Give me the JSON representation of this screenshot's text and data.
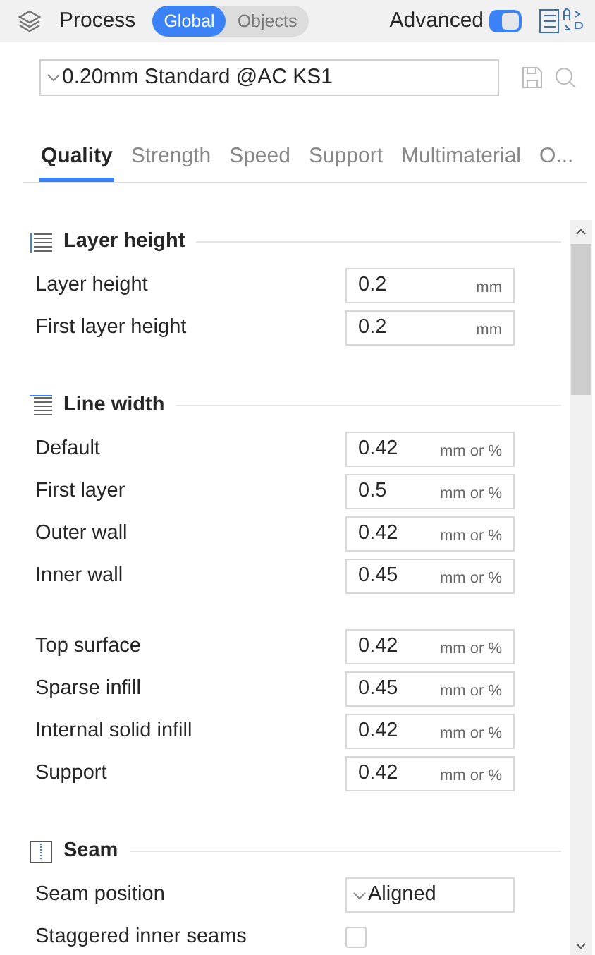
{
  "header": {
    "title": "Process",
    "scope": [
      {
        "label": "Global",
        "selected": true
      },
      {
        "label": "Objects",
        "selected": false
      }
    ],
    "advanced": {
      "label": "Advanced",
      "on": true
    }
  },
  "preset": {
    "value": "0.20mm Standard @AC KS1"
  },
  "tabs": [
    {
      "label": "Quality",
      "selected": true
    },
    {
      "label": "Strength",
      "selected": false
    },
    {
      "label": "Speed",
      "selected": false
    },
    {
      "label": "Support",
      "selected": false
    },
    {
      "label": "Multimaterial",
      "selected": false
    },
    {
      "label": "O...",
      "selected": false
    }
  ],
  "sections": [
    {
      "title": "Layer height",
      "groups": [
        [
          {
            "kind": "field",
            "label": "Layer height",
            "value": "0.2",
            "unit": "mm"
          },
          {
            "kind": "field",
            "label": "First layer height",
            "value": "0.2",
            "unit": "mm"
          }
        ]
      ]
    },
    {
      "title": "Line width",
      "groups": [
        [
          {
            "kind": "field",
            "label": "Default",
            "value": "0.42",
            "unit": "mm or %"
          },
          {
            "kind": "field",
            "label": "First layer",
            "value": "0.5",
            "unit": "mm or %"
          },
          {
            "kind": "field",
            "label": "Outer wall",
            "value": "0.42",
            "unit": "mm or %"
          },
          {
            "kind": "field",
            "label": "Inner wall",
            "value": "0.45",
            "unit": "mm or %"
          }
        ],
        [
          {
            "kind": "field",
            "label": "Top surface",
            "value": "0.42",
            "unit": "mm or %"
          },
          {
            "kind": "field",
            "label": "Sparse infill",
            "value": "0.45",
            "unit": "mm or %"
          },
          {
            "kind": "field",
            "label": "Internal solid infill",
            "value": "0.42",
            "unit": "mm or %"
          },
          {
            "kind": "field",
            "label": "Support",
            "value": "0.42",
            "unit": "mm or %"
          }
        ]
      ]
    },
    {
      "title": "Seam",
      "groups": [
        [
          {
            "kind": "dropdown",
            "label": "Seam position",
            "value": "Aligned"
          },
          {
            "kind": "checkbox",
            "label": "Staggered inner seams",
            "checked": false
          }
        ]
      ]
    }
  ]
}
